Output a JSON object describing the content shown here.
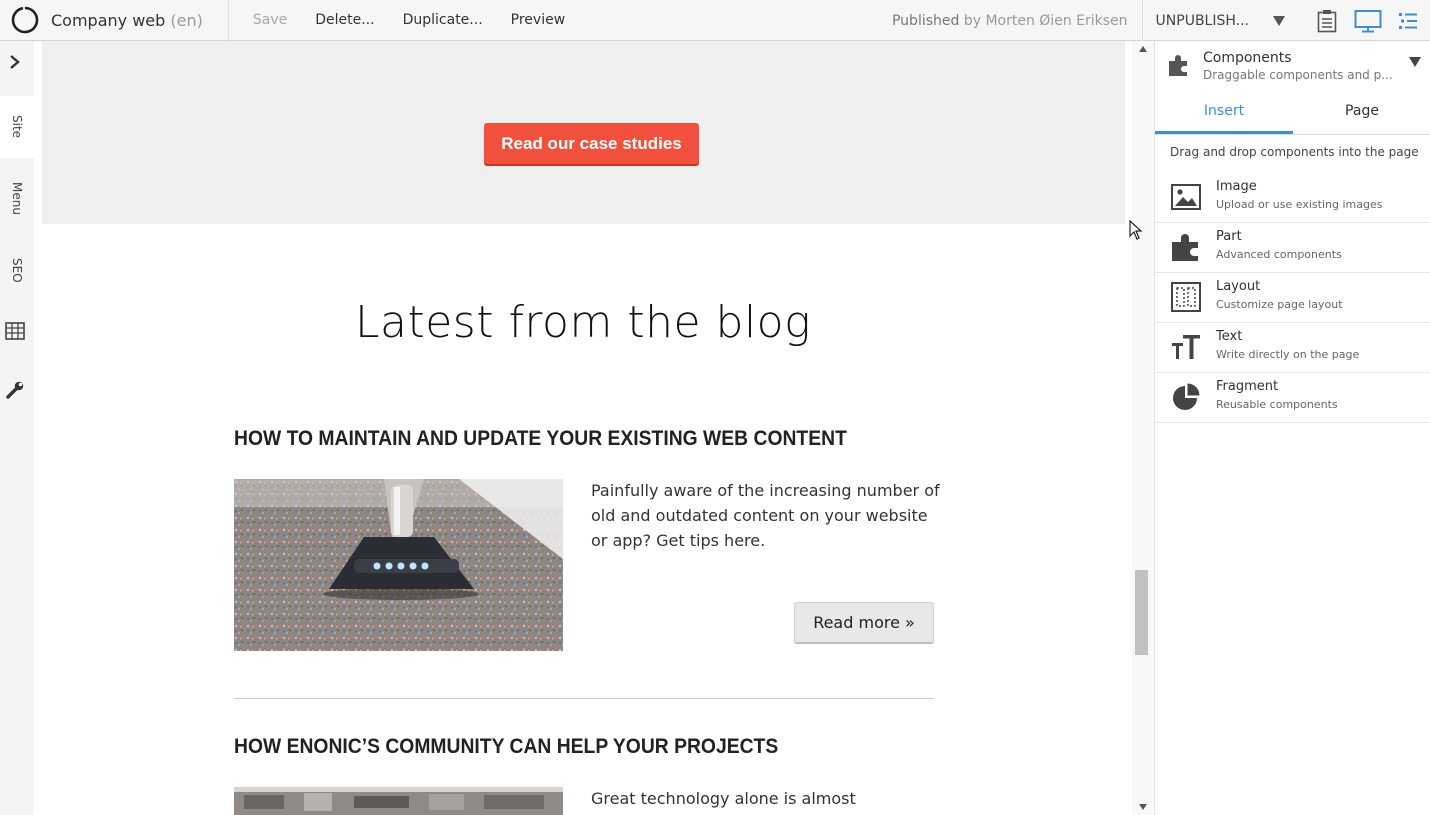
{
  "toolbar": {
    "app_title": "Company web",
    "app_lang": "(en)",
    "save_label": "Save",
    "delete_label": "Delete...",
    "duplicate_label": "Duplicate...",
    "preview_label": "Preview",
    "published_label": "Published",
    "published_by": "by Morten Øien Eriksen",
    "unpublish_label": "UNPUBLISH...",
    "icons": [
      "app-logo",
      "clipboard-icon",
      "desktop-icon",
      "list-icon"
    ],
    "accent_color": "#3c8fd5"
  },
  "leftbar": {
    "tabs": [
      "Site",
      "Menu",
      "SEO"
    ],
    "icons": [
      "expand-arrow-icon",
      "grid-icon",
      "wrench-icon"
    ]
  },
  "canvas": {
    "cta_label": "Read our case studies",
    "cta_color": "#f0503c",
    "blog_title": "Latest from the blog",
    "posts": [
      {
        "title": "HOW TO MAINTAIN AND UPDATE YOUR EXISTING WEB CONTENT",
        "text": "Painfully aware of the increasing number of old and outdated content on your website or app? Get tips here.",
        "read_more": "Read more »"
      },
      {
        "title": "HOW ENONIC’S COMMUNITY CAN HELP YOUR PROJECTS",
        "text": "Great technology alone is almost"
      }
    ]
  },
  "panel": {
    "title": "Components",
    "subtitle": "Draggable components and p...",
    "tabs": [
      "Insert",
      "Page"
    ],
    "active_tab": "Insert",
    "hint": "Drag and drop components into the page",
    "items": [
      {
        "title": "Image",
        "subtitle": "Upload or use existing images",
        "icon": "image-icon"
      },
      {
        "title": "Part",
        "subtitle": "Advanced components",
        "icon": "puzzle-icon"
      },
      {
        "title": "Layout",
        "subtitle": "Customize page layout",
        "icon": "layout-icon"
      },
      {
        "title": "Text",
        "subtitle": "Write directly on the page",
        "icon": "text-icon"
      },
      {
        "title": "Fragment",
        "subtitle": "Reusable components",
        "icon": "pie-icon"
      }
    ]
  }
}
